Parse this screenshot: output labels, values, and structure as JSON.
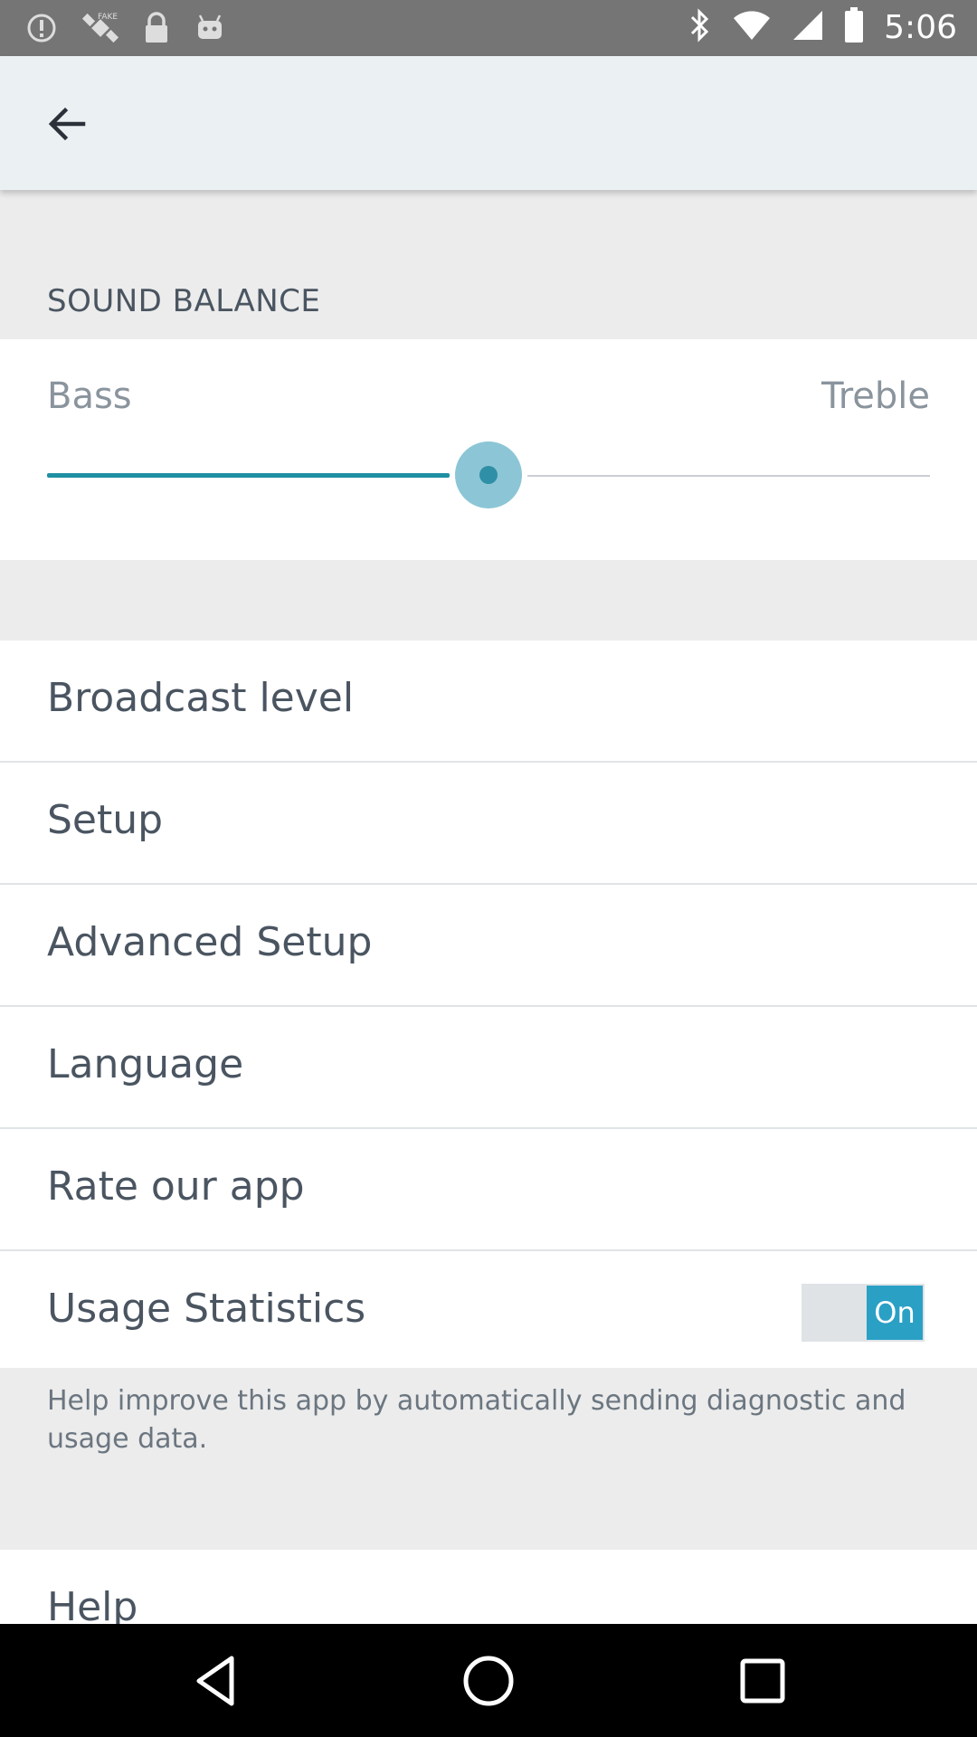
{
  "status_bar": {
    "time": "5:06",
    "icons": [
      "alert-icon",
      "satellite-icon",
      "lock-icon",
      "android-icon",
      "bluetooth-icon",
      "wifi-icon",
      "signal-icon",
      "battery-icon"
    ]
  },
  "app_bar": {
    "back_icon": "arrow-back-icon"
  },
  "sound_balance": {
    "header": "SOUND BALANCE",
    "left_label": "Bass",
    "right_label": "Treble",
    "value_fraction": 0.5,
    "accent_color": "#1f8fa3"
  },
  "menu": {
    "items": [
      {
        "label": "Broadcast level"
      },
      {
        "label": "Setup"
      },
      {
        "label": "Advanced Setup"
      },
      {
        "label": "Language"
      },
      {
        "label": "Rate our app"
      }
    ],
    "usage_statistics": {
      "label": "Usage Statistics",
      "toggle_state": "On",
      "toggle_color": "#2aa0c5"
    },
    "usage_description": "Help improve this app by automatically sending diagnostic and usage data.",
    "help_label": "Help"
  },
  "nav_bar": {
    "icons": [
      "back-triangle-icon",
      "home-circle-icon",
      "recents-square-icon"
    ]
  }
}
